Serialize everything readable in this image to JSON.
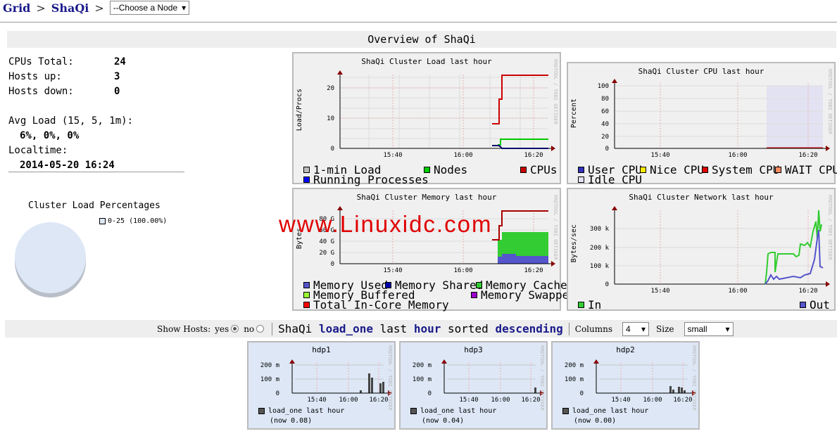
{
  "breadcrumb": {
    "grid": "Grid",
    "sep": ">",
    "cluster": "ShaQi",
    "node_select": "--Choose a Node"
  },
  "overview_title": "Overview of ShaQi",
  "stats": {
    "cpus_label": "CPUs Total:",
    "cpus_value": "24",
    "hosts_up_label": "Hosts up:",
    "hosts_up_value": "3",
    "hosts_down_label": "Hosts down:",
    "hosts_down_value": "0",
    "avg_load_label": "Avg Load (15, 5, 1m):",
    "avg_load_value": "6%, 0%, 0%",
    "localtime_label": "Localtime:",
    "localtime_value": "2014-05-20 16:24"
  },
  "pie": {
    "title": "Cluster Load Percentages",
    "legend": "0-25 (100.00%)",
    "color": "#dde7f6"
  },
  "graphs": {
    "load": {
      "title": "ShaQi Cluster Load last hour",
      "ylabel": "Load/Procs",
      "yticks": [
        "20",
        "10",
        "0"
      ],
      "xticks": [
        "15:40",
        "16:00",
        "16:20"
      ],
      "legend": {
        "one": "1-min Load",
        "nodes": "Nodes",
        "cpus": "CPUs",
        "procs": "Running Processes"
      }
    },
    "cpu": {
      "title": "ShaQi Cluster CPU last hour",
      "ylabel": "Percent",
      "yticks": [
        "100",
        "80",
        "60",
        "40",
        "20",
        "0"
      ],
      "xticks": [
        "15:40",
        "16:00",
        "16:20"
      ],
      "legend": {
        "user": "User CPU",
        "nice": "Nice CPU",
        "system": "System CPU",
        "wait": "WAIT CPU",
        "idle": "Idle CPU"
      }
    },
    "memory": {
      "title": "ShaQi Cluster Memory last hour",
      "ylabel": "Bytes",
      "yticks": [
        "80 G",
        "60 G",
        "40 G",
        "20 G",
        "0"
      ],
      "xticks": [
        "15:40",
        "16:00",
        "16:20"
      ],
      "legend": {
        "used": "Memory Used",
        "shared": "Memory Shared",
        "cached": "Memory Cached",
        "buffered": "Memory Buffered",
        "swapped": "Memory Swapped",
        "incore": "Total In-Core Memory"
      }
    },
    "network": {
      "title": "ShaQi Cluster Network last hour",
      "ylabel": "Bytes/sec",
      "yticks": [
        "300 k",
        "200 k",
        "100 k",
        "0"
      ],
      "xticks": [
        "15:40",
        "16:00",
        "16:20"
      ],
      "legend": {
        "in": "In",
        "out": "Out"
      }
    }
  },
  "watermark": "www.Linuxidc.com",
  "rrdtool": "RRDTOOL / TOBI OETIKER",
  "toolbar": {
    "show_hosts": "Show Hosts:",
    "yes": "yes",
    "no": "no",
    "cluster": "ShaQi",
    "metric": "load_one",
    "last": "last",
    "range": "hour",
    "sorted": "sorted",
    "order": "descending",
    "columns_label": "Columns",
    "columns_value": "4",
    "size_label": "Size",
    "size_value": "small"
  },
  "hosts": [
    {
      "name": "hdp1",
      "metric": "load_one last hour",
      "now": "(now 0.08)"
    },
    {
      "name": "hdp3",
      "metric": "load_one last hour",
      "now": "(now 0.04)"
    },
    {
      "name": "hdp2",
      "metric": "load_one last hour",
      "now": "(now 0.00)"
    }
  ],
  "host_graph": {
    "yticks": [
      "200 m",
      "100 m",
      "0"
    ],
    "xticks": [
      "15:40",
      "16:00",
      "16:20"
    ]
  },
  "colors": {
    "cpus": "#cc0000",
    "nodes": "#00cc00",
    "one": "#bbbbbb",
    "procs": "#0000ff",
    "user": "#3333bb",
    "nice": "#ffea00",
    "system": "#dd0000",
    "wait": "#ff8a60",
    "idle": "#e2e2f2",
    "mem_used": "#5555cc",
    "mem_shared": "#0000aa",
    "mem_cached": "#33cc33",
    "mem_buffered": "#99ff33",
    "mem_swapped": "#9900cc",
    "mem_incore": "#ff0000",
    "net_in": "#33cc33",
    "net_out": "#5555cc"
  }
}
